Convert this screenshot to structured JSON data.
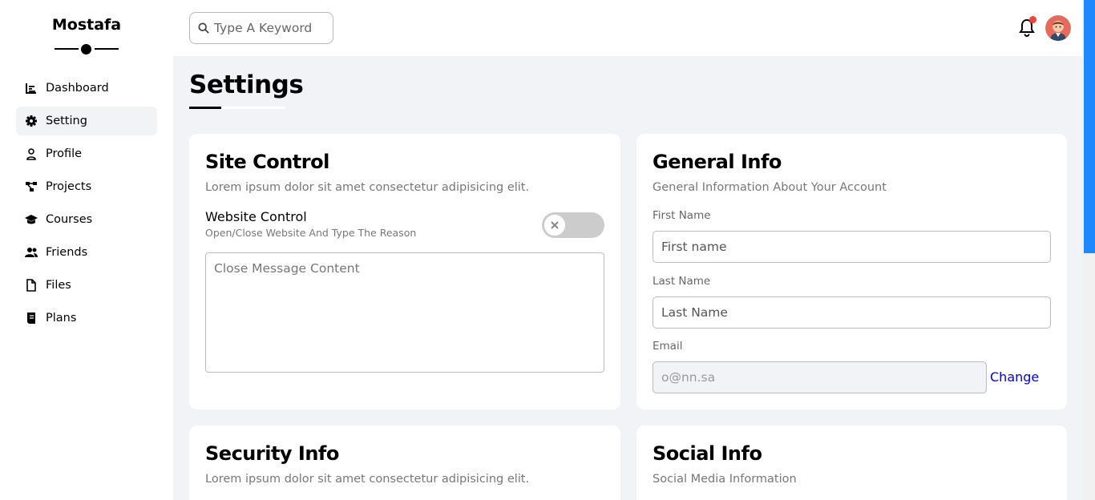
{
  "brand": {
    "name": "Mostafa"
  },
  "sidebar": {
    "items": [
      {
        "label": "Dashboard",
        "icon": "chart-icon",
        "active": false
      },
      {
        "label": "Setting",
        "icon": "gear-icon",
        "active": true
      },
      {
        "label": "Profile",
        "icon": "user-icon",
        "active": false
      },
      {
        "label": "Projects",
        "icon": "diagram-project-icon",
        "active": false
      },
      {
        "label": "Courses",
        "icon": "graduation-cap-icon",
        "active": false
      },
      {
        "label": "Friends",
        "icon": "users-icon",
        "active": false
      },
      {
        "label": "Files",
        "icon": "file-icon",
        "active": false
      },
      {
        "label": "Plans",
        "icon": "plan-icon",
        "active": false
      }
    ]
  },
  "header": {
    "search_placeholder": "Type A Keyword",
    "notification_badge_color": "#f44336"
  },
  "page": {
    "title": "Settings"
  },
  "site_control": {
    "title": "Site Control",
    "description": "Lorem ipsum dolor sit amet consectetur adipisicing elit.",
    "toggle_title": "Website Control",
    "toggle_subtitle": "Open/Close Website And Type The Reason",
    "toggle_state": "off",
    "message_placeholder": "Close Message Content"
  },
  "general_info": {
    "title": "General Info",
    "description": "General Information About Your Account",
    "first_name_label": "First Name",
    "first_name_placeholder": "First name",
    "last_name_label": "Last Name",
    "last_name_placeholder": "Last Name",
    "email_label": "Email",
    "email_placeholder": "o@nn.sa",
    "change_label": "Change"
  },
  "security_info": {
    "title": "Security Info",
    "description": "Lorem ipsum dolor sit amet consectetur adipisicing elit."
  },
  "social_info": {
    "title": "Social Info",
    "description": "Social Media Information"
  },
  "colors": {
    "accent": "#1e88ff",
    "link": "#0000ee",
    "background": "#f1f3f7"
  }
}
